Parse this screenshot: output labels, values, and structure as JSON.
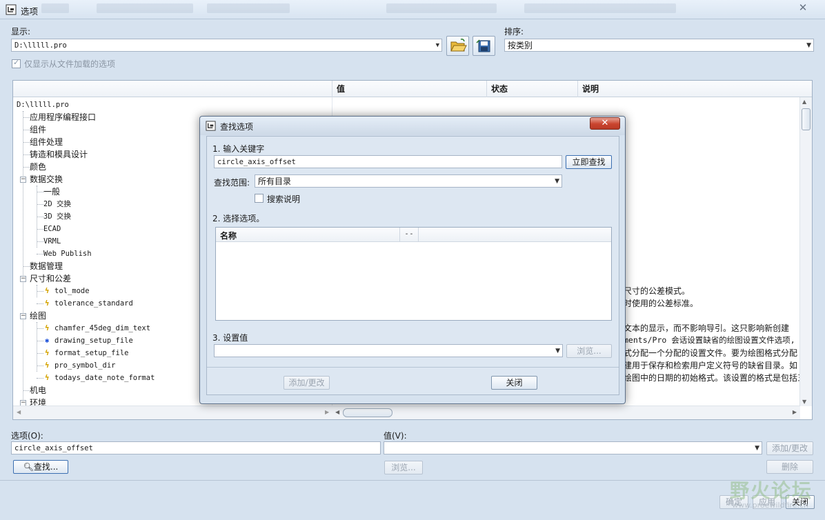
{
  "window": {
    "title": "选项",
    "close_glyph": "✕"
  },
  "display": {
    "label": "显示:",
    "value": "D:\\lllll.pro"
  },
  "sort": {
    "label": "排序:",
    "value": "按类别"
  },
  "only_loaded": {
    "label": "仅显示从文件加载的选项",
    "checked": true
  },
  "columns": {
    "value": "值",
    "status": "状态",
    "description": "说明"
  },
  "tree": {
    "root": "D:\\lllll.pro",
    "items": [
      {
        "label": "应用程序编程接口"
      },
      {
        "label": "组件"
      },
      {
        "label": "组件处理"
      },
      {
        "label": "铸造和模具设计"
      },
      {
        "label": "颜色"
      },
      {
        "label": "数据交换",
        "children": [
          "一般",
          "2D 交换",
          "3D 交换",
          "ECAD",
          "VRML",
          "Web Publish"
        ]
      },
      {
        "label": "数据管理"
      },
      {
        "label": "尺寸和公差",
        "children": [
          "tol_mode",
          "tolerance_standard"
        ]
      },
      {
        "label": "绘图",
        "children": [
          "chamfer_45deg_dim_text",
          "drawing_setup_file",
          "format_setup_file",
          "pro_symbol_dir",
          "todays_date_note_format"
        ]
      },
      {
        "label": "机电"
      },
      {
        "label": "环境"
      }
    ]
  },
  "descriptions": {
    "tol_mode": "尺寸的公差模式。",
    "tolerance_standard": "时使用的公差标准。",
    "chamfer": "文本的显示，而不影响导引。这只影响新创建",
    "drawing_setup": "ments/Pro 会话设置缺省的绘图设置文件选项,",
    "format_setup": "式分配一个分配的设置文件。要为绘图格式分配",
    "symbol_dir": "建用于保存和检索用户定义符号的缺省目录。如",
    "date_format": "绘图中的日期的初始格式。该设置的格式是包括三"
  },
  "bottom": {
    "option_label": "选项(O):",
    "option_value": "circle_axis_offset",
    "value_label": "值(V):",
    "value_value": "",
    "add_change": "添加/更改",
    "delete": "删除",
    "find": "查找...",
    "browse": "浏览...",
    "ok": "确定",
    "apply": "应用",
    "close": "关闭"
  },
  "dialog": {
    "title": "查找选项",
    "close_glyph": "✕",
    "step1": "1.   输入关键字",
    "keyword": "circle_axis_offset",
    "find_now": "立即查找",
    "scope_label": "查找范围:",
    "scope_value": "所有目录",
    "search_desc": "搜索说明",
    "search_desc_checked": false,
    "step2": "2.   选择选项。",
    "col_name": "名称",
    "col_extra": "- -",
    "step3": "3.   设置值",
    "set_value": "",
    "browse": "浏览...",
    "add_change": "添加/更改",
    "close": "关闭"
  },
  "watermark": {
    "text": "野火论坛",
    "sub": "www.proewildfire.cn"
  },
  "colors": {
    "window_bg": "#d6e2ef",
    "dialog_close": "#c9442e",
    "bolt": "#d4a300",
    "bolt_blue": "#1b4fd8"
  }
}
